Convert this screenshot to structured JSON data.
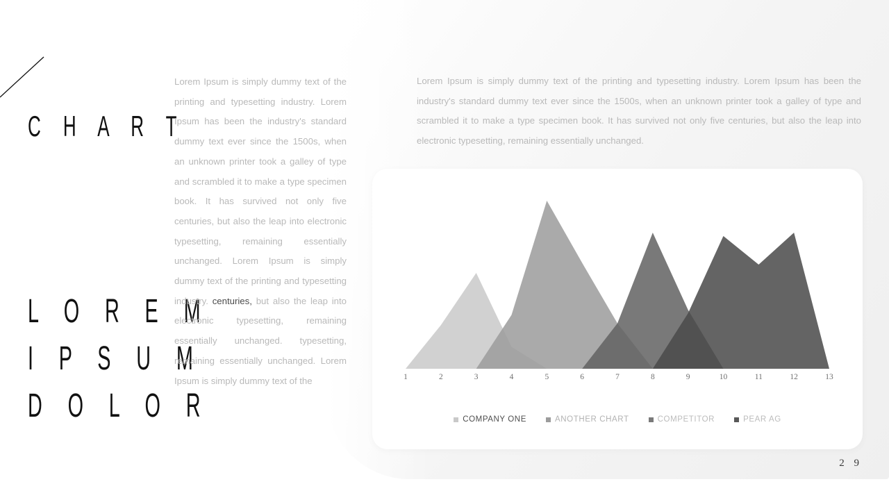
{
  "slide": {
    "title": "C H A R T",
    "subtitle_lines": [
      "L O R E M",
      "I P S U M",
      "D O L O R"
    ],
    "page_number": "2 9"
  },
  "left_copy": {
    "part1": "Lorem Ipsum is simply dummy text of the printing and typesetting industry. Lorem Ipsum has been the industry's standard dummy text ever since the 1500s, when an unknown printer took a galley of type and scrambled it to make a type specimen book. It has survived not only five centuries, but also the leap into electronic typesetting, remaining essentially unchanged. Lorem Ipsum is simply dummy text of the printing and typesetting industry. ",
    "emphasis": "centuries,",
    "part2": " but also the leap into electronic typesetting, remaining essentially unchanged. typesetting, remaining essentially unchanged. Lorem Ipsum is simply dummy text of the"
  },
  "right_copy": {
    "text": "Lorem Ipsum is simply dummy text of the printing and typesetting industry. Lorem Ipsum has been the industry's standard dummy text ever since the 1500s, when an unknown printer took a galley of type and scrambled it to make a type specimen book. It has survived not only five centuries, but also the leap into electronic typesetting, remaining essentially unchanged."
  },
  "chart_data": {
    "type": "area",
    "title": "",
    "xlabel": "",
    "ylabel": "",
    "grid": false,
    "legend_position": "bottom",
    "categories": [
      "1",
      "2",
      "3",
      "4",
      "5",
      "6",
      "7",
      "8",
      "9",
      "10",
      "11",
      "12",
      "13"
    ],
    "xlim": [
      1,
      13
    ],
    "ylim": [
      0,
      100
    ],
    "series": [
      {
        "name": "COMPANY ONE",
        "color": "#c9c9c9",
        "values": [
          0,
          26,
          57,
          13,
          0,
          0,
          0,
          0,
          0,
          0,
          0,
          0,
          0
        ]
      },
      {
        "name": "ANOTHER CHART",
        "color": "#9c9c9c",
        "values": [
          0,
          0,
          0,
          32,
          100,
          63,
          27,
          0,
          0,
          0,
          0,
          0,
          0
        ]
      },
      {
        "name": "COMPETITOR",
        "color": "#636363",
        "values": [
          0,
          0,
          0,
          0,
          0,
          0,
          27,
          81,
          35,
          0,
          0,
          0,
          0
        ]
      },
      {
        "name": "PEAR AG",
        "color": "#4b4b4b",
        "values": [
          0,
          0,
          0,
          0,
          0,
          0,
          0,
          0,
          33,
          79,
          62,
          81,
          0
        ]
      }
    ]
  },
  "legend": {
    "items": [
      {
        "label": "COMPANY ONE",
        "color": "#c9c9c9",
        "text_color": "#4d4d4d"
      },
      {
        "label": "ANOTHER CHART",
        "color": "#9c9c9c",
        "text_color": "#b2b2b2"
      },
      {
        "label": "COMPETITOR",
        "color": "#7a7a7a",
        "text_color": "#bcbcbc"
      },
      {
        "label": "PEAR AG",
        "color": "#585858",
        "text_color": "#bcbcbc"
      }
    ]
  },
  "colors": {
    "panel": "#f1f1f1",
    "card": "#ffffff",
    "body_text": "#b9b9b9",
    "axis_text": "#6f6f6f"
  }
}
